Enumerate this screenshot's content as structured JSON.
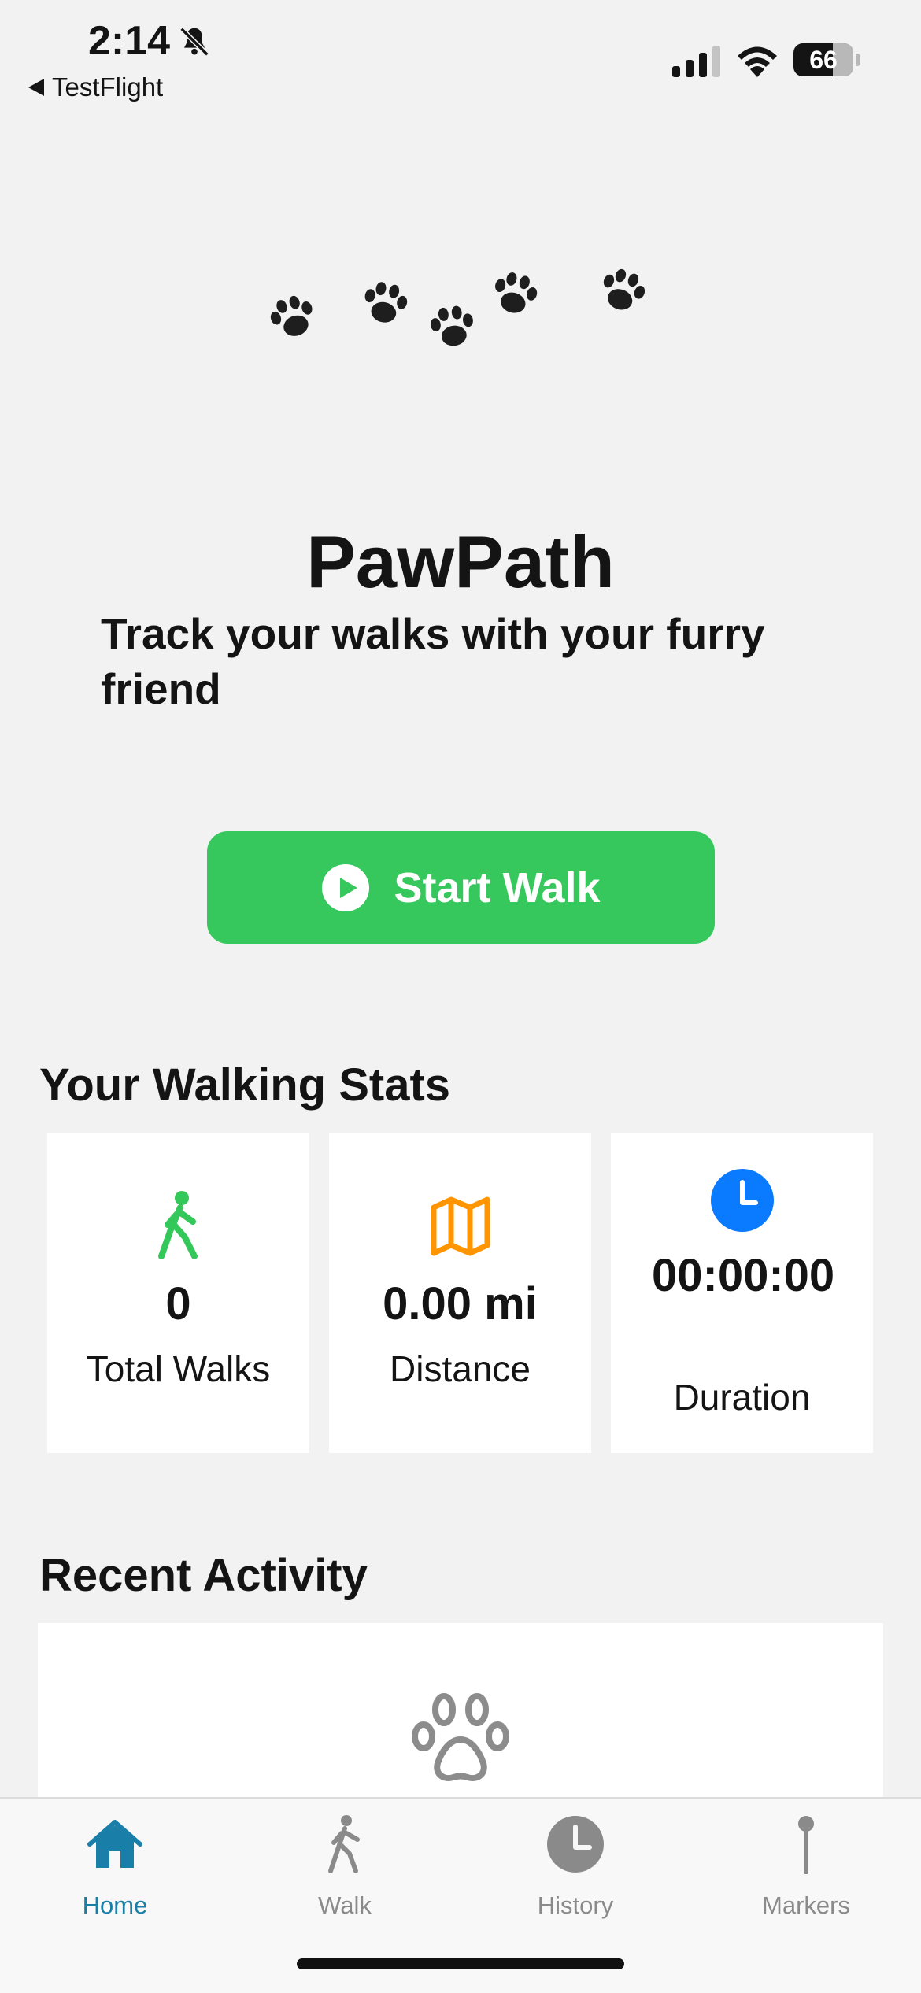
{
  "status_bar": {
    "time": "2:14",
    "back_app": "TestFlight",
    "battery": "66"
  },
  "header": {
    "title": "PawPath",
    "subtitle": "Track your walks with your furry friend"
  },
  "start_button": {
    "label": "Start Walk"
  },
  "stats": {
    "title": "Your Walking Stats",
    "cards": [
      {
        "icon": "walking-person-icon",
        "color": "#34c759",
        "value": "0",
        "label": "Total Walks"
      },
      {
        "icon": "map-icon",
        "color": "#ff9500",
        "value": "0.00 mi",
        "label": "Distance"
      },
      {
        "icon": "clock-icon",
        "color": "#0a7aff",
        "value": "00:00:00",
        "label": "Duration"
      }
    ]
  },
  "recent": {
    "title": "Recent Activity",
    "empty_icon": "paw-outline-icon"
  },
  "tabs": [
    {
      "label": "Home",
      "icon": "home-icon",
      "active": true
    },
    {
      "label": "Walk",
      "icon": "walk-icon",
      "active": false
    },
    {
      "label": "History",
      "icon": "history-clock-icon",
      "active": false
    },
    {
      "label": "Markers",
      "icon": "pin-icon",
      "active": false
    }
  ],
  "colors": {
    "accent_green": "#36c85c",
    "tab_active": "#1a7fa8",
    "tab_inactive": "#8a8a8a",
    "background": "#f2f2f2"
  }
}
